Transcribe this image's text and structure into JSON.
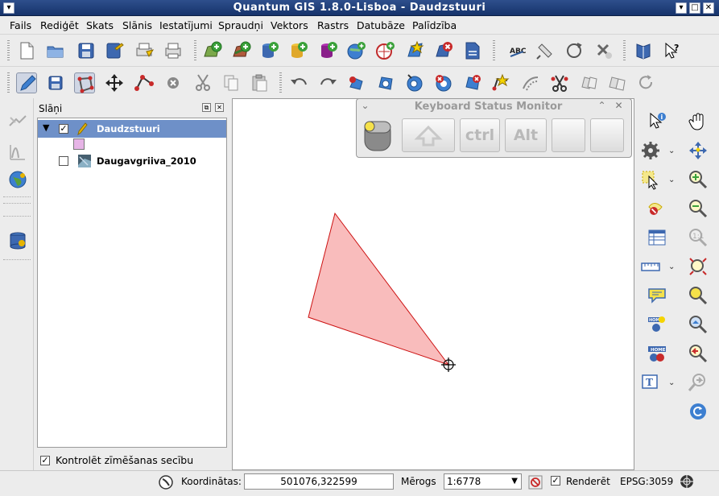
{
  "window": {
    "title": "Quantum GIS 1.8.0-Lisboa - Daudzstuuri"
  },
  "menu": {
    "items": [
      "Fails",
      "Rediģēt",
      "Skats",
      "Slānis",
      "Iestatījumi",
      "Spraudņi",
      "Vektors",
      "Rastrs",
      "Datubāze",
      "Palīdzība"
    ]
  },
  "layers_panel": {
    "title": "Slāņi",
    "layers": [
      {
        "name": "Daudzstuuri",
        "checked": true,
        "selected": true
      },
      {
        "name": "Daugavgriiva_2010",
        "checked": false,
        "selected": false
      }
    ],
    "render_order_label": "Kontrolēt zīmēšanas secību",
    "render_order_checked": true
  },
  "keyboard_monitor": {
    "title": "Keyboard Status Monitor",
    "keys": [
      "",
      "ctrl",
      "Alt",
      "",
      ""
    ]
  },
  "map": {
    "polygon_fill": "#f9bcbc",
    "polygon_stroke": "#cc1111"
  },
  "status": {
    "coordinates_label": "Koordinātas:",
    "coordinates_value": "501076,322599",
    "scale_label": "Mērogs",
    "scale_value": "1:6778",
    "render_label": "Renderēt",
    "render_checked": true,
    "crs": "EPSG:3059"
  },
  "colors": {
    "titlebar": "#1f3f7a",
    "selection": "#6e90c8",
    "accent": "#2e4f8c"
  }
}
